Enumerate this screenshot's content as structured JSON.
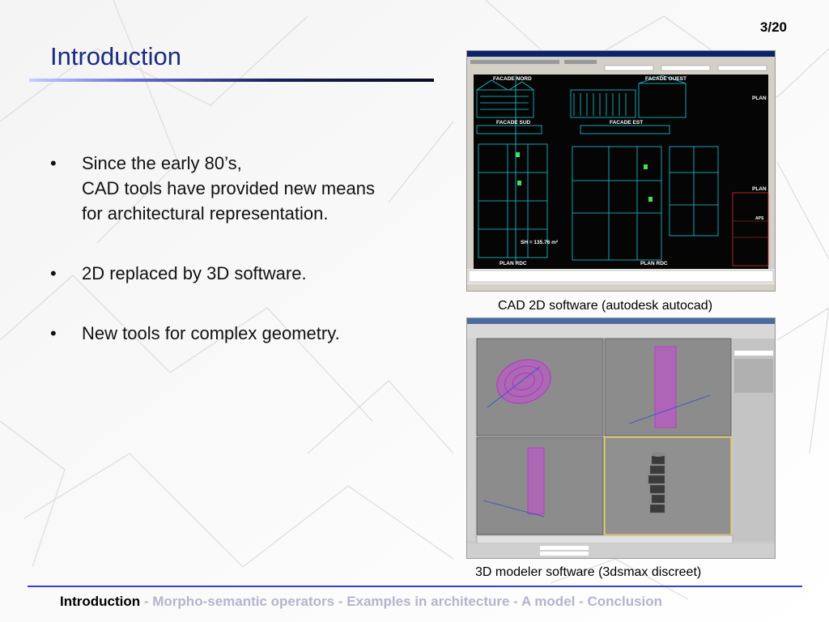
{
  "slide": {
    "page_number": "3/20",
    "title": "Introduction",
    "bullets": [
      {
        "lines": [
          "Since the early 80’s,",
          "CAD tools have provided new means",
          "for architectural representation."
        ]
      },
      {
        "lines": [
          "2D replaced by 3D software."
        ]
      },
      {
        "lines": [
          "New tools for complex geometry."
        ]
      }
    ],
    "bullet_char": "•"
  },
  "figures": {
    "autocad": {
      "caption": "CAD 2D software (autodesk autocad)",
      "labels": [
        "FACADE NORD",
        "FACADE OUEST",
        "FACADE SUD",
        "FACADE EST",
        "PLAN",
        "PLAN",
        "SH = 135.76 m²",
        "PLAN RDC",
        "PLAN RDC",
        "APS"
      ]
    },
    "max3ds": {
      "caption": "3D modeler software (3dsmax discreet)"
    }
  },
  "footer": {
    "items": [
      {
        "label": "Introduction",
        "active": true
      },
      {
        "label": "Morpho-semantic operators",
        "active": false
      },
      {
        "label": "Examples in architecture",
        "active": false
      },
      {
        "label": "A model",
        "active": false
      },
      {
        "label": "Conclusion",
        "active": false
      }
    ],
    "separator": " - "
  },
  "colors": {
    "title": "#1a2a80",
    "footer_rule": "#3b3fd0",
    "footer_inactive": "#b4b4cf",
    "cad_background": "#050505",
    "cad_lines": "#1ec8d8",
    "max_wireframe": "#c020d0"
  }
}
